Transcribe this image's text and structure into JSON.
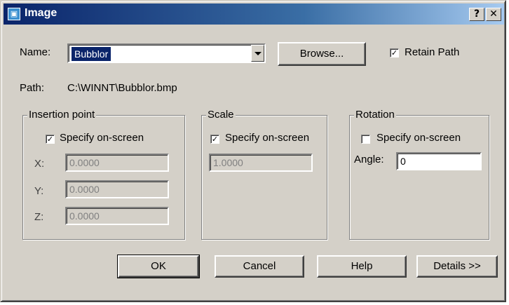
{
  "dialog": {
    "title": "Image",
    "help_glyph": "?",
    "close_glyph": "✕"
  },
  "name": {
    "label": "Name:",
    "value": "Bubblor"
  },
  "browse_label": "Browse...",
  "retain_path": {
    "label": "Retain Path",
    "checked": true
  },
  "path": {
    "label": "Path:",
    "value": "C:\\WINNT\\Bubblor.bmp"
  },
  "insertion": {
    "title": "Insertion point",
    "specify_label": "Specify on-screen",
    "specify_checked": true,
    "x_label": "X:",
    "x_value": "0.0000",
    "y_label": "Y:",
    "y_value": "0.0000",
    "z_label": "Z:",
    "z_value": "0.0000"
  },
  "scale": {
    "title": "Scale",
    "specify_label": "Specify on-screen",
    "specify_checked": true,
    "value": "1.0000"
  },
  "rotation": {
    "title": "Rotation",
    "specify_label": "Specify on-screen",
    "specify_checked": false,
    "angle_label": "Angle:",
    "angle_value": "0"
  },
  "buttons": {
    "ok": "OK",
    "cancel": "Cancel",
    "help": "Help",
    "details": "Details >>"
  },
  "colors": {
    "titlebar_start": "#0a246a",
    "face": "#d4d0c8",
    "selection": "#0a246a"
  }
}
